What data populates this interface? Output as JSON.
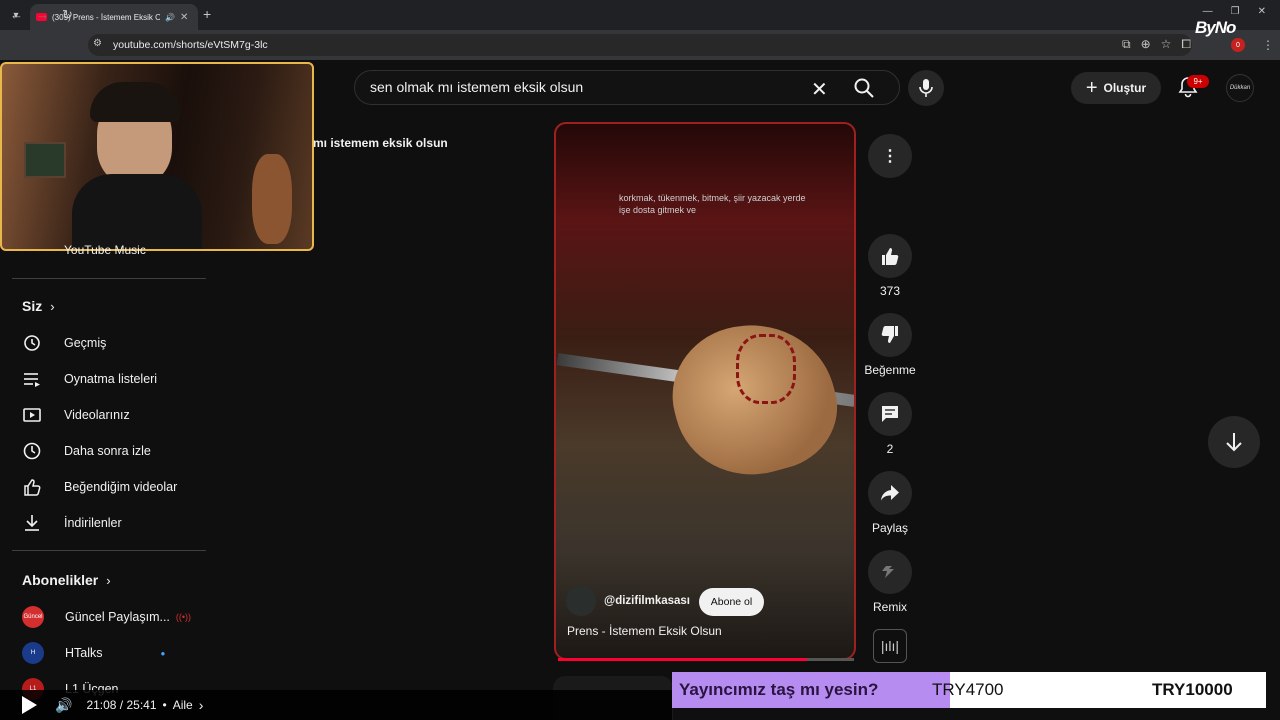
{
  "browser": {
    "tab_title": "(309) Prens - İstemem Eksik O",
    "url": "youtube.com/shorts/eVtSM7g-3lc",
    "new_tab": "+",
    "profile_badge": "0"
  },
  "overlay_logo": "ByNo",
  "header": {
    "search_value": "sen olmak mı istemem eksik olsun",
    "create_label": "Oluştur",
    "notif_count": "9+",
    "avatar_text": "Dükkan"
  },
  "truncated_query": "mı istemem eksik olsun",
  "sidebar": {
    "hidden_item": "YouTube Music",
    "you_header": "Siz",
    "you_items": [
      {
        "label": "Geçmiş",
        "icon": "history-icon"
      },
      {
        "label": "Oynatma listeleri",
        "icon": "playlist-icon"
      },
      {
        "label": "Videolarınız",
        "icon": "your-videos-icon"
      },
      {
        "label": "Daha sonra izle",
        "icon": "watch-later-icon"
      },
      {
        "label": "Beğendiğim videolar",
        "icon": "liked-icon"
      },
      {
        "label": "İndirilenler",
        "icon": "download-icon"
      }
    ],
    "subs_header": "Abonelikler",
    "subs": [
      {
        "label": "Güncel Paylaşım...",
        "color": "#d32f2f",
        "av": "Güncel"
      },
      {
        "label": "HTalks",
        "color": "#1a3a8a",
        "av": "H"
      },
      {
        "label": "L1 Üçgen",
        "color": "#b71c1c",
        "av": "L1"
      }
    ]
  },
  "short": {
    "caption": "korkmak, tükenmek, bitmek, şiir yazacak yerde işe dosta gitmek ve",
    "channel": "@dizifilmkasası",
    "subscribe_label": "Abone ol",
    "title": "Prens - İstemem Eksik Olsun",
    "progress": 0.84
  },
  "actions": {
    "likes": "373",
    "dislike_label": "Beğenme",
    "comments": "2",
    "share_label": "Paylaş",
    "remix_label": "Remix"
  },
  "player": {
    "time": "21:08 / 25:41",
    "chapter": "Aile"
  },
  "donation": {
    "question": "Yayıncımız taş mı yesin?",
    "current": "TRY4700",
    "goal": "TRY10000"
  }
}
